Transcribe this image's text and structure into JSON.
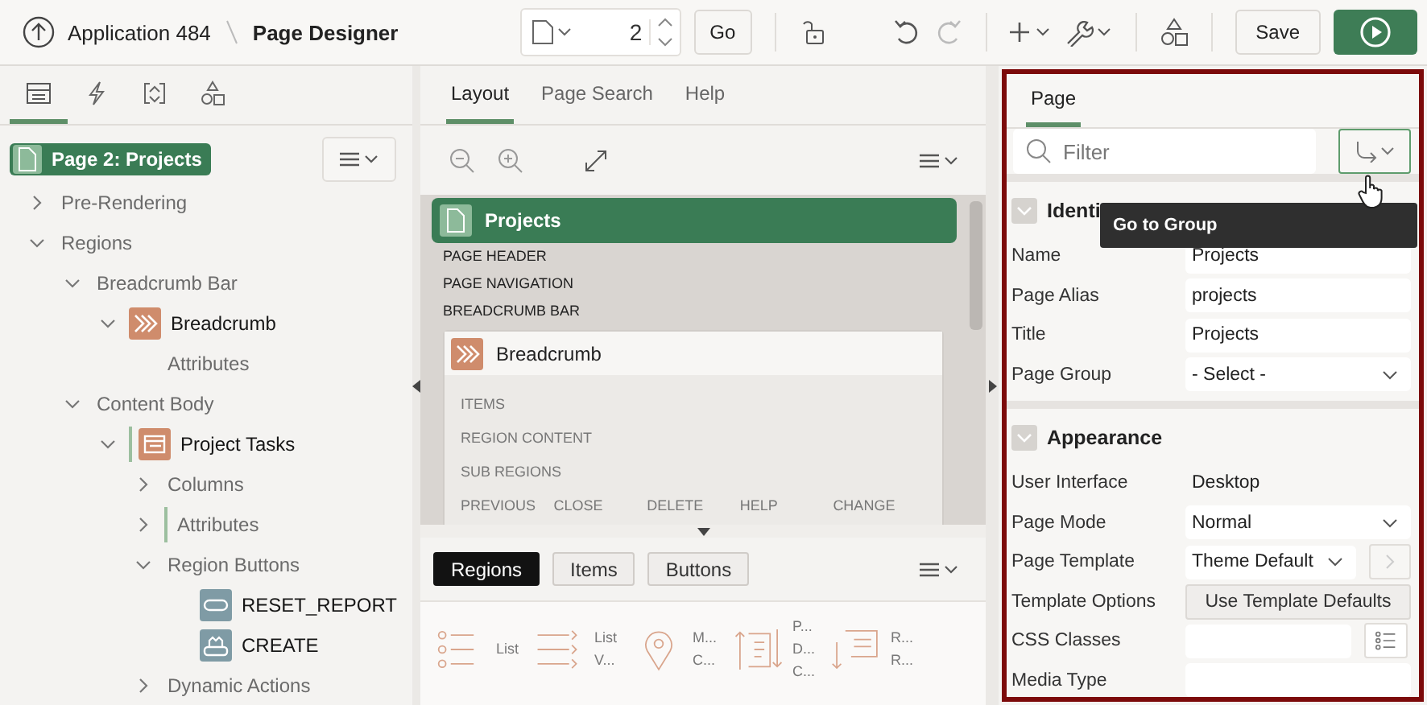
{
  "header": {
    "app": "Application 484",
    "title": "Page Designer",
    "page_number": "2",
    "go": "Go",
    "save": "Save"
  },
  "left": {
    "tabs": [
      {
        "kind": "rendering",
        "selected": true
      },
      {
        "kind": "dynamic",
        "selected": false
      },
      {
        "kind": "processing",
        "selected": false
      },
      {
        "kind": "shared",
        "selected": false
      }
    ],
    "page": "Page 2: Projects",
    "tree": [
      {
        "label": "Pre-Rendering",
        "expanded": false
      },
      {
        "label": "Regions",
        "expanded": true,
        "children": [
          {
            "label": "Breadcrumb Bar",
            "expanded": true,
            "children": [
              {
                "label": "Breadcrumb",
                "kind": "breadcrumb",
                "expanded": true,
                "children": [
                  {
                    "label": "Attributes"
                  }
                ]
              }
            ]
          },
          {
            "label": "Content Body",
            "expanded": true,
            "children": [
              {
                "label": "Project Tasks",
                "kind": "report",
                "expanded": true,
                "marked": true,
                "children": [
                  {
                    "label": "Columns",
                    "expanded": false
                  },
                  {
                    "label": "Attributes",
                    "expanded": false,
                    "marked": true
                  },
                  {
                    "label": "Region Buttons",
                    "expanded": true,
                    "children": [
                      {
                        "label": "RESET_REPORT",
                        "kind": "button"
                      },
                      {
                        "label": "CREATE",
                        "kind": "create"
                      }
                    ]
                  },
                  {
                    "label": "Dynamic Actions",
                    "expanded": false
                  }
                ]
              }
            ]
          }
        ]
      }
    ]
  },
  "middle": {
    "tabs": [
      {
        "label": "Layout",
        "selected": true
      },
      {
        "label": "Page Search",
        "selected": false
      },
      {
        "label": "Help",
        "selected": false
      }
    ],
    "page": "Projects",
    "positions": [
      "PAGE HEADER",
      "PAGE NAVIGATION",
      "BREADCRUMB BAR"
    ],
    "region": {
      "title": "Breadcrumb",
      "slots": [
        "ITEMS",
        "REGION CONTENT",
        "SUB REGIONS"
      ],
      "buttons": [
        "PREVIOUS",
        "CLOSE",
        "DELETE",
        "HELP",
        "CHANGE"
      ]
    },
    "gallery_tabs": [
      {
        "label": "Regions",
        "selected": true
      },
      {
        "label": "Items",
        "selected": false
      },
      {
        "label": "Buttons",
        "selected": false
      }
    ],
    "gallery": [
      {
        "kind": "list",
        "lines": [
          "List"
        ]
      },
      {
        "kind": "list_view",
        "lines": [
          "List",
          "V..."
        ]
      },
      {
        "kind": "map",
        "lines": [
          "M...",
          "C..."
        ]
      },
      {
        "kind": "timeline",
        "lines": [
          "P...",
          "D...",
          "C..."
        ]
      },
      {
        "kind": "reflow",
        "lines": [
          "R...",
          "R..."
        ]
      }
    ]
  },
  "right": {
    "tab": "Page",
    "filter_placeholder": "Filter",
    "tooltip": "Go to Group",
    "sections": [
      {
        "title": "Identi",
        "expanded": true,
        "fields": [
          {
            "label": "Name",
            "kind": "text",
            "value": "Projects"
          },
          {
            "label": "Page Alias",
            "kind": "text",
            "value": "projects"
          },
          {
            "label": "Title",
            "kind": "text",
            "value": "Projects"
          },
          {
            "label": "Page Group",
            "kind": "select",
            "value": "- Select -"
          }
        ]
      },
      {
        "title": "Appearance",
        "expanded": true,
        "fields": [
          {
            "label": "User Interface",
            "kind": "display",
            "value": "Desktop"
          },
          {
            "label": "Page Mode",
            "kind": "select",
            "value": "Normal"
          },
          {
            "label": "Page Template",
            "kind": "select_link",
            "value": "Theme Default"
          },
          {
            "label": "Template Options",
            "kind": "button",
            "value": "Use Template Defaults"
          },
          {
            "label": "CSS Classes",
            "kind": "picker"
          },
          {
            "label": "Media Type",
            "kind": "text"
          }
        ]
      }
    ]
  }
}
